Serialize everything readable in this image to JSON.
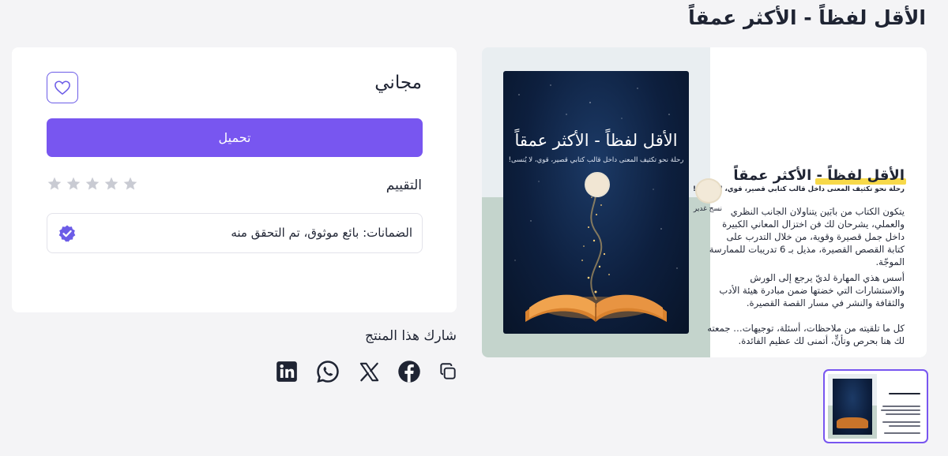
{
  "product": {
    "title": "الأقل لفظاً - الأكثر عمقاً",
    "price": "مجاني",
    "download_label": "تحميل",
    "rating_label": "التقييم",
    "stars_filled": 0,
    "stars_total": 5,
    "guarantee": "الضمانات: بائع موثوق، تم التحقق منه"
  },
  "share": {
    "title": "شارك هذا المنتج",
    "icons": [
      "copy-link-icon",
      "facebook-icon",
      "x-twitter-icon",
      "whatsapp-icon",
      "linkedin-icon"
    ]
  },
  "gallery_image": {
    "cover_title": "الأقل لفظاً - الأكثر عمقاً",
    "cover_subtitle": "رحلة نحو تكثيف المعنى داخل قالب كتابي قصير، قوي، لا يُنسى!",
    "info_title": "الأقل لفظاً - الأكثر عمقاً",
    "info_subtitle": "رحلة نحو تكثيف المعنى داخل قالب كتابي قصير، قوي، لا يُنسى!",
    "author": "نسج غدير",
    "paragraphs": [
      "يتكون الكتاب من بابَين يتناولان الجانب النظري والعملي، يشرحان لك فن اختزال المعاني الكبيرة داخل جمل قصيرة وقوية، من خلال التدرب على كتابة القصص القصيرة، مذيل بـ 6 تدريبات للممارسة الموجّة.",
      "أسس هذي المهارة لديّ يرجع إلى الورش والاستشارات التي خضتها ضمن مبادرة هيئة الأدب والثقافة والنشر في مسار القصة القصيرة.",
      "كل ما تلقيته من ملاحظات، أسئلة، توجيهات… جمعته لك هنا بحرص وتأنٍّ، أتمنى لك عظيم الفائدة."
    ]
  },
  "colors": {
    "accent": "#7856f0",
    "verified": "#6c5ce7",
    "star_empty": "#c9cbd3",
    "highlight": "#f7d94a"
  }
}
